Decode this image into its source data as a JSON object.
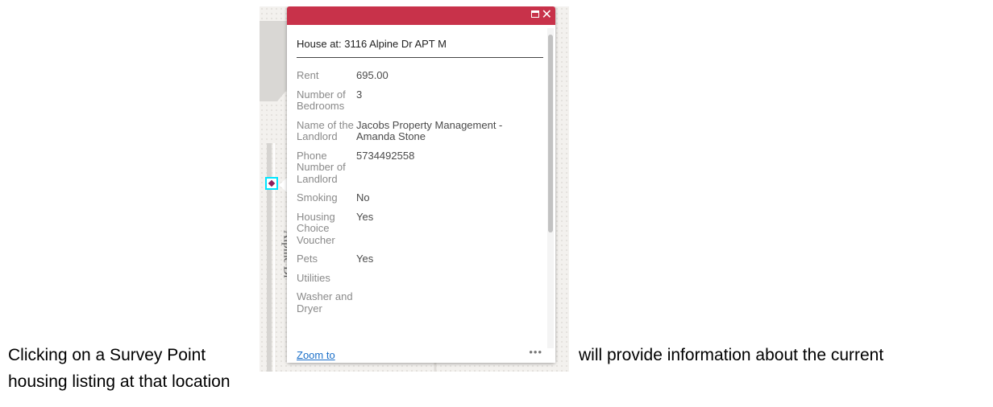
{
  "document": {
    "sentence_part1": "Clicking on a Survey Point",
    "sentence_part2": "will provide information about the current",
    "sentence_part3": "housing listing at that location"
  },
  "map": {
    "street_label": "Alpine Dr",
    "colors": {
      "popup_header": "#c8324a",
      "survey_point_border": "#00e5ff",
      "survey_point_fill": "#8e1f5c",
      "link": "#1a6fc9"
    }
  },
  "popup": {
    "title": "House at: 3116 Alpine Dr APT M",
    "header_buttons": {
      "maximize_icon": "maximize-icon",
      "close_label": "✕"
    },
    "attributes": [
      {
        "name": "Rent",
        "value": "695.00"
      },
      {
        "name": "Number of Bedrooms",
        "value": "3"
      },
      {
        "name": "Name of the Landlord",
        "value": "Jacobs Property Management - Amanda Stone"
      },
      {
        "name": "Phone Number of Landlord",
        "value": "5734492558"
      },
      {
        "name": "Smoking",
        "value": "No"
      },
      {
        "name": "Housing Choice Voucher",
        "value": "Yes"
      },
      {
        "name": "Pets",
        "value": "Yes"
      },
      {
        "name": "Utilities",
        "value": ""
      },
      {
        "name": "Washer and Dryer",
        "value": ""
      }
    ],
    "footer": {
      "zoom_label": "Zoom to",
      "more_label": "•••"
    }
  }
}
